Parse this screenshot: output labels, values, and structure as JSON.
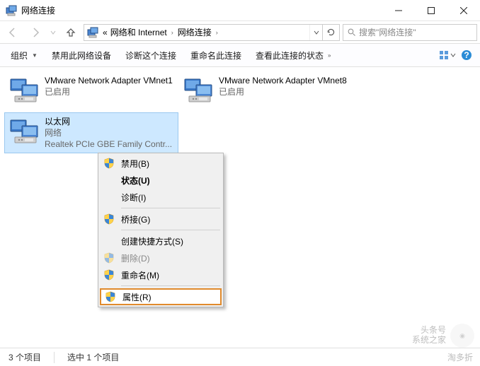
{
  "window": {
    "title": "网络连接"
  },
  "nav": {
    "crumb1": "网络和 Internet",
    "crumb2": "网络连接",
    "search_placeholder": "搜索\"网络连接\""
  },
  "toolbar": {
    "organize": "组织",
    "disable": "禁用此网络设备",
    "diagnose": "诊断这个连接",
    "rename": "重命名此连接",
    "status": "查看此连接的状态"
  },
  "adapters": [
    {
      "name": "VMware Network Adapter VMnet1",
      "sub1": "已启用",
      "sub2": ""
    },
    {
      "name": "VMware Network Adapter VMnet8",
      "sub1": "已启用",
      "sub2": ""
    },
    {
      "name": "以太网",
      "sub1": "网络",
      "sub2": "Realtek PCIe GBE Family Contr..."
    }
  ],
  "context": {
    "disable": "禁用(B)",
    "status": "状态(U)",
    "diagnose": "诊断(I)",
    "bridge": "桥接(G)",
    "shortcut": "创建快捷方式(S)",
    "delete": "删除(D)",
    "rename": "重命名(M)",
    "properties": "属性(R)"
  },
  "statusbar": {
    "count": "3 个项目",
    "selected": "选中 1 个项目"
  },
  "watermark": {
    "line1": "头条号",
    "line2": "系统之家",
    "corner": "淘多折"
  }
}
